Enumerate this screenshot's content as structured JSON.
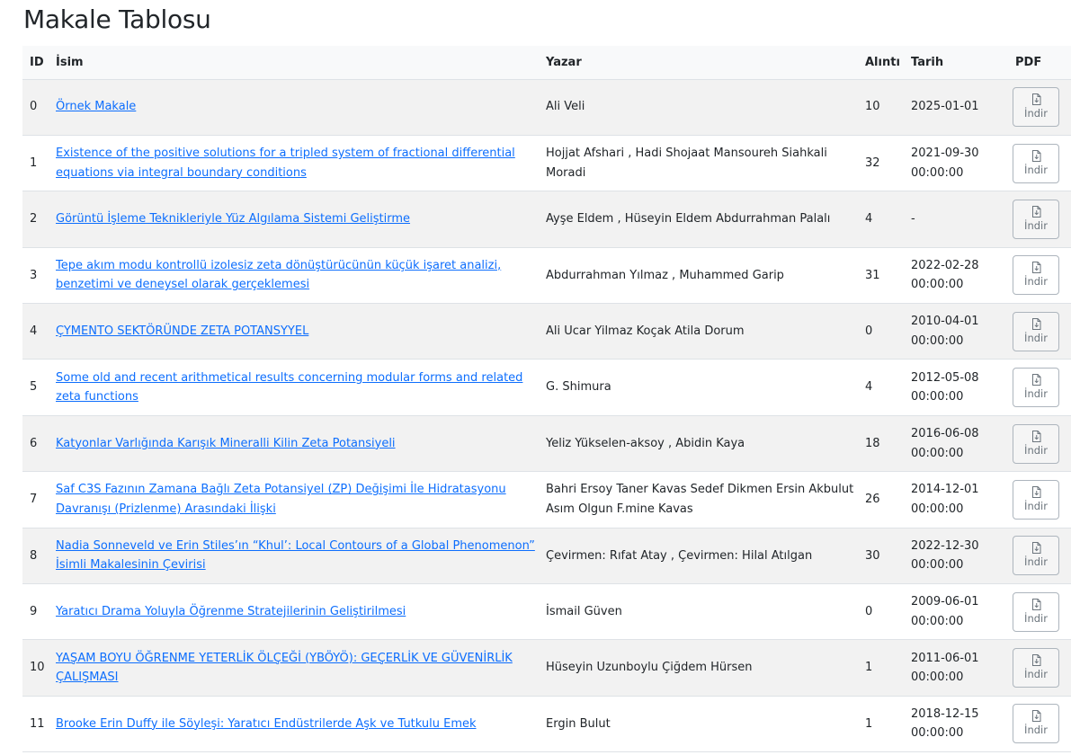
{
  "page": {
    "title": "Makale Tablosu"
  },
  "table": {
    "headers": {
      "id": "ID",
      "name": "İsim",
      "author": "Yazar",
      "citations": "Alıntı",
      "date": "Tarih",
      "pdf": "PDF"
    },
    "download_label": "İndir",
    "download_icon": "file-download-icon",
    "rows": [
      {
        "id": "0",
        "title": "Örnek Makale",
        "authors": "Ali Veli",
        "citations": "10",
        "date": "2025-01-01"
      },
      {
        "id": "1",
        "title": "Existence of the positive solutions for a tripled system of fractional differential equations via integral boundary conditions",
        "authors": "Hojjat Afshari , Hadi Shojaat Mansoureh Siahkali Moradi",
        "citations": "32",
        "date": "2021-09-30 00:00:00"
      },
      {
        "id": "2",
        "title": "Görüntü İşleme Teknikleriyle Yüz Algılama Sistemi Geliştirme",
        "authors": "Ayşe Eldem , Hüseyin Eldem Abdurrahman Palalı",
        "citations": "4",
        "date": "-"
      },
      {
        "id": "3",
        "title": "Tepe akım modu kontrollü izolesiz zeta dönüştürücünün küçük işaret analizi, benzetimi ve deneysel olarak gerçeklemesi",
        "authors": "Abdurrahman Yılmaz , Muhammed Garip",
        "citations": "31",
        "date": "2022-02-28 00:00:00"
      },
      {
        "id": "4",
        "title": "ÇYMENTO SEKTÖRÜNDE ZETA POTANSYYEL",
        "authors": "Ali Ucar Yilmaz Koçak Atila Dorum",
        "citations": "0",
        "date": "2010-04-01 00:00:00"
      },
      {
        "id": "5",
        "title": "Some old and recent arithmetical results concerning modular forms and related zeta functions",
        "authors": "G. Shimura",
        "citations": "4",
        "date": "2012-05-08 00:00:00"
      },
      {
        "id": "6",
        "title": "Katyonlar Varlığında Karışık Mineralli Kilin Zeta Potansiyeli",
        "authors": "Yeliz Yükselen-aksoy , Abidin Kaya",
        "citations": "18",
        "date": "2016-06-08 00:00:00"
      },
      {
        "id": "7",
        "title": "Saf C3S Fazının Zamana Bağlı Zeta Potansiyel (ZP) Değişimi İle Hidratasyonu Davranışı (Prizlenme) Arasındaki İlişki",
        "authors": "Bahri Ersoy Taner Kavas Sedef Dikmen Ersin Akbulut Asım Olgun F.mine Kavas",
        "citations": "26",
        "date": "2014-12-01 00:00:00"
      },
      {
        "id": "8",
        "title": "Nadia Sonneveld ve Erin Stiles’ın “Khul’: Local Contours of a Global Phenomenon” İsimli Makalesinin Çevirisi",
        "authors": "Çevirmen: Rıfat Atay , Çevirmen: Hilal Atılgan",
        "citations": "30",
        "date": "2022-12-30 00:00:00"
      },
      {
        "id": "9",
        "title": "Yaratıcı Drama Yoluyla Öğrenme Stratejilerinin Geliştirilmesi",
        "authors": "İsmail Güven",
        "citations": "0",
        "date": "2009-06-01 00:00:00"
      },
      {
        "id": "10",
        "title": "YAŞAM BOYU ÖĞRENME YETERLİK ÖLÇEĞİ (YBÖYÖ): GEÇERLİK VE GÜVENİRLİK ÇALIŞMASI",
        "authors": "Hüseyin Uzunboylu Çiğdem Hürsen",
        "citations": "1",
        "date": "2011-06-01 00:00:00"
      },
      {
        "id": "11",
        "title": "Brooke Erin Duffy ile Söyleşi: Yaratıcı Endüstrilerde Aşk ve Tutkulu Emek",
        "authors": "Ergin Bulut",
        "citations": "1",
        "date": "2018-12-15 00:00:00"
      }
    ]
  }
}
